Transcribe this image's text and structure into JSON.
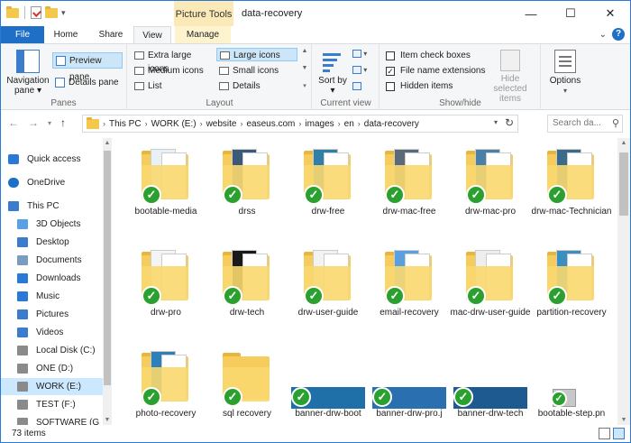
{
  "window": {
    "title": "data-recovery",
    "context_tab": "Picture Tools",
    "controls": {
      "minimize": "—",
      "maximize": "☐",
      "close": "✕"
    }
  },
  "ribbon_tabs": {
    "file": "File",
    "home": "Home",
    "share": "Share",
    "view": "View",
    "manage": "Manage",
    "active": "View"
  },
  "ribbon": {
    "panes": {
      "label": "Panes",
      "navigation_pane": "Navigation pane ▾",
      "preview_pane": "Preview pane",
      "details_pane": "Details pane"
    },
    "layout": {
      "label": "Layout",
      "items": [
        "Extra large icons",
        "Large icons",
        "Medium icons",
        "Small icons",
        "List",
        "Details"
      ],
      "selected": "Large icons"
    },
    "current_view": {
      "label": "Current view",
      "sort_by": "Sort by ▾"
    },
    "show_hide": {
      "label": "Show/hide",
      "item_check_boxes": "Item check boxes",
      "item_check_boxes_checked": false,
      "file_name_extensions": "File name extensions",
      "file_name_extensions_checked": true,
      "hidden_items": "Hidden items",
      "hidden_items_checked": false,
      "hide_selected": "Hide selected items"
    },
    "options": {
      "label": "Options"
    }
  },
  "address": {
    "crumbs": [
      "This PC",
      "WORK (E:)",
      "website",
      "easeus.com",
      "images",
      "en",
      "data-recovery"
    ],
    "search_placeholder": "Search da..."
  },
  "nav_tree": {
    "items": [
      {
        "label": "Quick access",
        "icon": "star-icon",
        "color": "#2b79d6"
      },
      {
        "label": "OneDrive",
        "icon": "cloud-icon",
        "color": "#1f6fc6"
      },
      {
        "label": "This PC",
        "icon": "monitor-icon",
        "color": "#3c7ccd"
      },
      {
        "label": "3D Objects",
        "icon": "cube-icon",
        "color": "#5aa0e6"
      },
      {
        "label": "Desktop",
        "icon": "desktop-icon",
        "color": "#3c7ccd"
      },
      {
        "label": "Documents",
        "icon": "document-icon",
        "color": "#7a9cc0"
      },
      {
        "label": "Downloads",
        "icon": "download-icon",
        "color": "#2b79d6"
      },
      {
        "label": "Music",
        "icon": "music-icon",
        "color": "#2b79d6"
      },
      {
        "label": "Pictures",
        "icon": "picture-icon",
        "color": "#3c7ccd"
      },
      {
        "label": "Videos",
        "icon": "video-icon",
        "color": "#3c7ccd"
      },
      {
        "label": "Local Disk (C:)",
        "icon": "disk-icon",
        "color": "#8a8a8a"
      },
      {
        "label": "ONE (D:)",
        "icon": "drive-icon",
        "color": "#8a8a8a"
      },
      {
        "label": "WORK (E:)",
        "icon": "drive-icon",
        "color": "#8a8a8a"
      },
      {
        "label": "TEST (F:)",
        "icon": "drive-icon",
        "color": "#8a8a8a"
      },
      {
        "label": "SOFTWARE (G",
        "icon": "drive-icon",
        "color": "#8a8a8a"
      }
    ],
    "selected": "WORK (E:)"
  },
  "files": [
    {
      "name": "bootable-media",
      "kind": "folder",
      "paper": "#e8f0f8"
    },
    {
      "name": "drss",
      "kind": "folder",
      "paper": "#3b5a7a"
    },
    {
      "name": "drw-free",
      "kind": "folder",
      "paper": "#2f7fa8"
    },
    {
      "name": "drw-mac-free",
      "kind": "folder",
      "paper": "#5a6a78"
    },
    {
      "name": "drw-mac-pro",
      "kind": "folder",
      "paper": "#4a7fa8"
    },
    {
      "name": "drw-mac-Technician",
      "kind": "folder",
      "paper": "#3a6b8a"
    },
    {
      "name": "drw-pro",
      "kind": "folder",
      "paper": "#f4f4f4"
    },
    {
      "name": "drw-tech",
      "kind": "folder",
      "paper": "#1a1a1a"
    },
    {
      "name": "drw-user-guide",
      "kind": "folder",
      "paper": "#f2f2f2"
    },
    {
      "name": "email-recovery",
      "kind": "folder",
      "paper": "#5aa0e0"
    },
    {
      "name": "mac-drw-user-guide",
      "kind": "folder",
      "paper": "#eeeeee"
    },
    {
      "name": "partition-recovery",
      "kind": "folder",
      "paper": "#3a8fc0"
    },
    {
      "name": "photo-recovery",
      "kind": "folder",
      "paper": "#2f7fb8"
    },
    {
      "name": "sql recovery",
      "kind": "folder-empty",
      "paper": ""
    },
    {
      "name": "banner-drw-boot",
      "kind": "image",
      "paper": "#1f6fa8"
    },
    {
      "name": "banner-drw-pro.j",
      "kind": "image",
      "paper": "#2a6fb0"
    },
    {
      "name": "banner-drw-tech",
      "kind": "image",
      "paper": "#1e5a90"
    },
    {
      "name": "bootable-step.pn",
      "kind": "image-small",
      "paper": "#c8c8c8"
    }
  ],
  "status": {
    "count": "73 items"
  },
  "colors": {
    "accent": "#1f6fc6",
    "context_tab": "#fbeab7",
    "selection": "#cde6f7",
    "folder": "#f6cd5c",
    "check": "#2aa02f"
  }
}
